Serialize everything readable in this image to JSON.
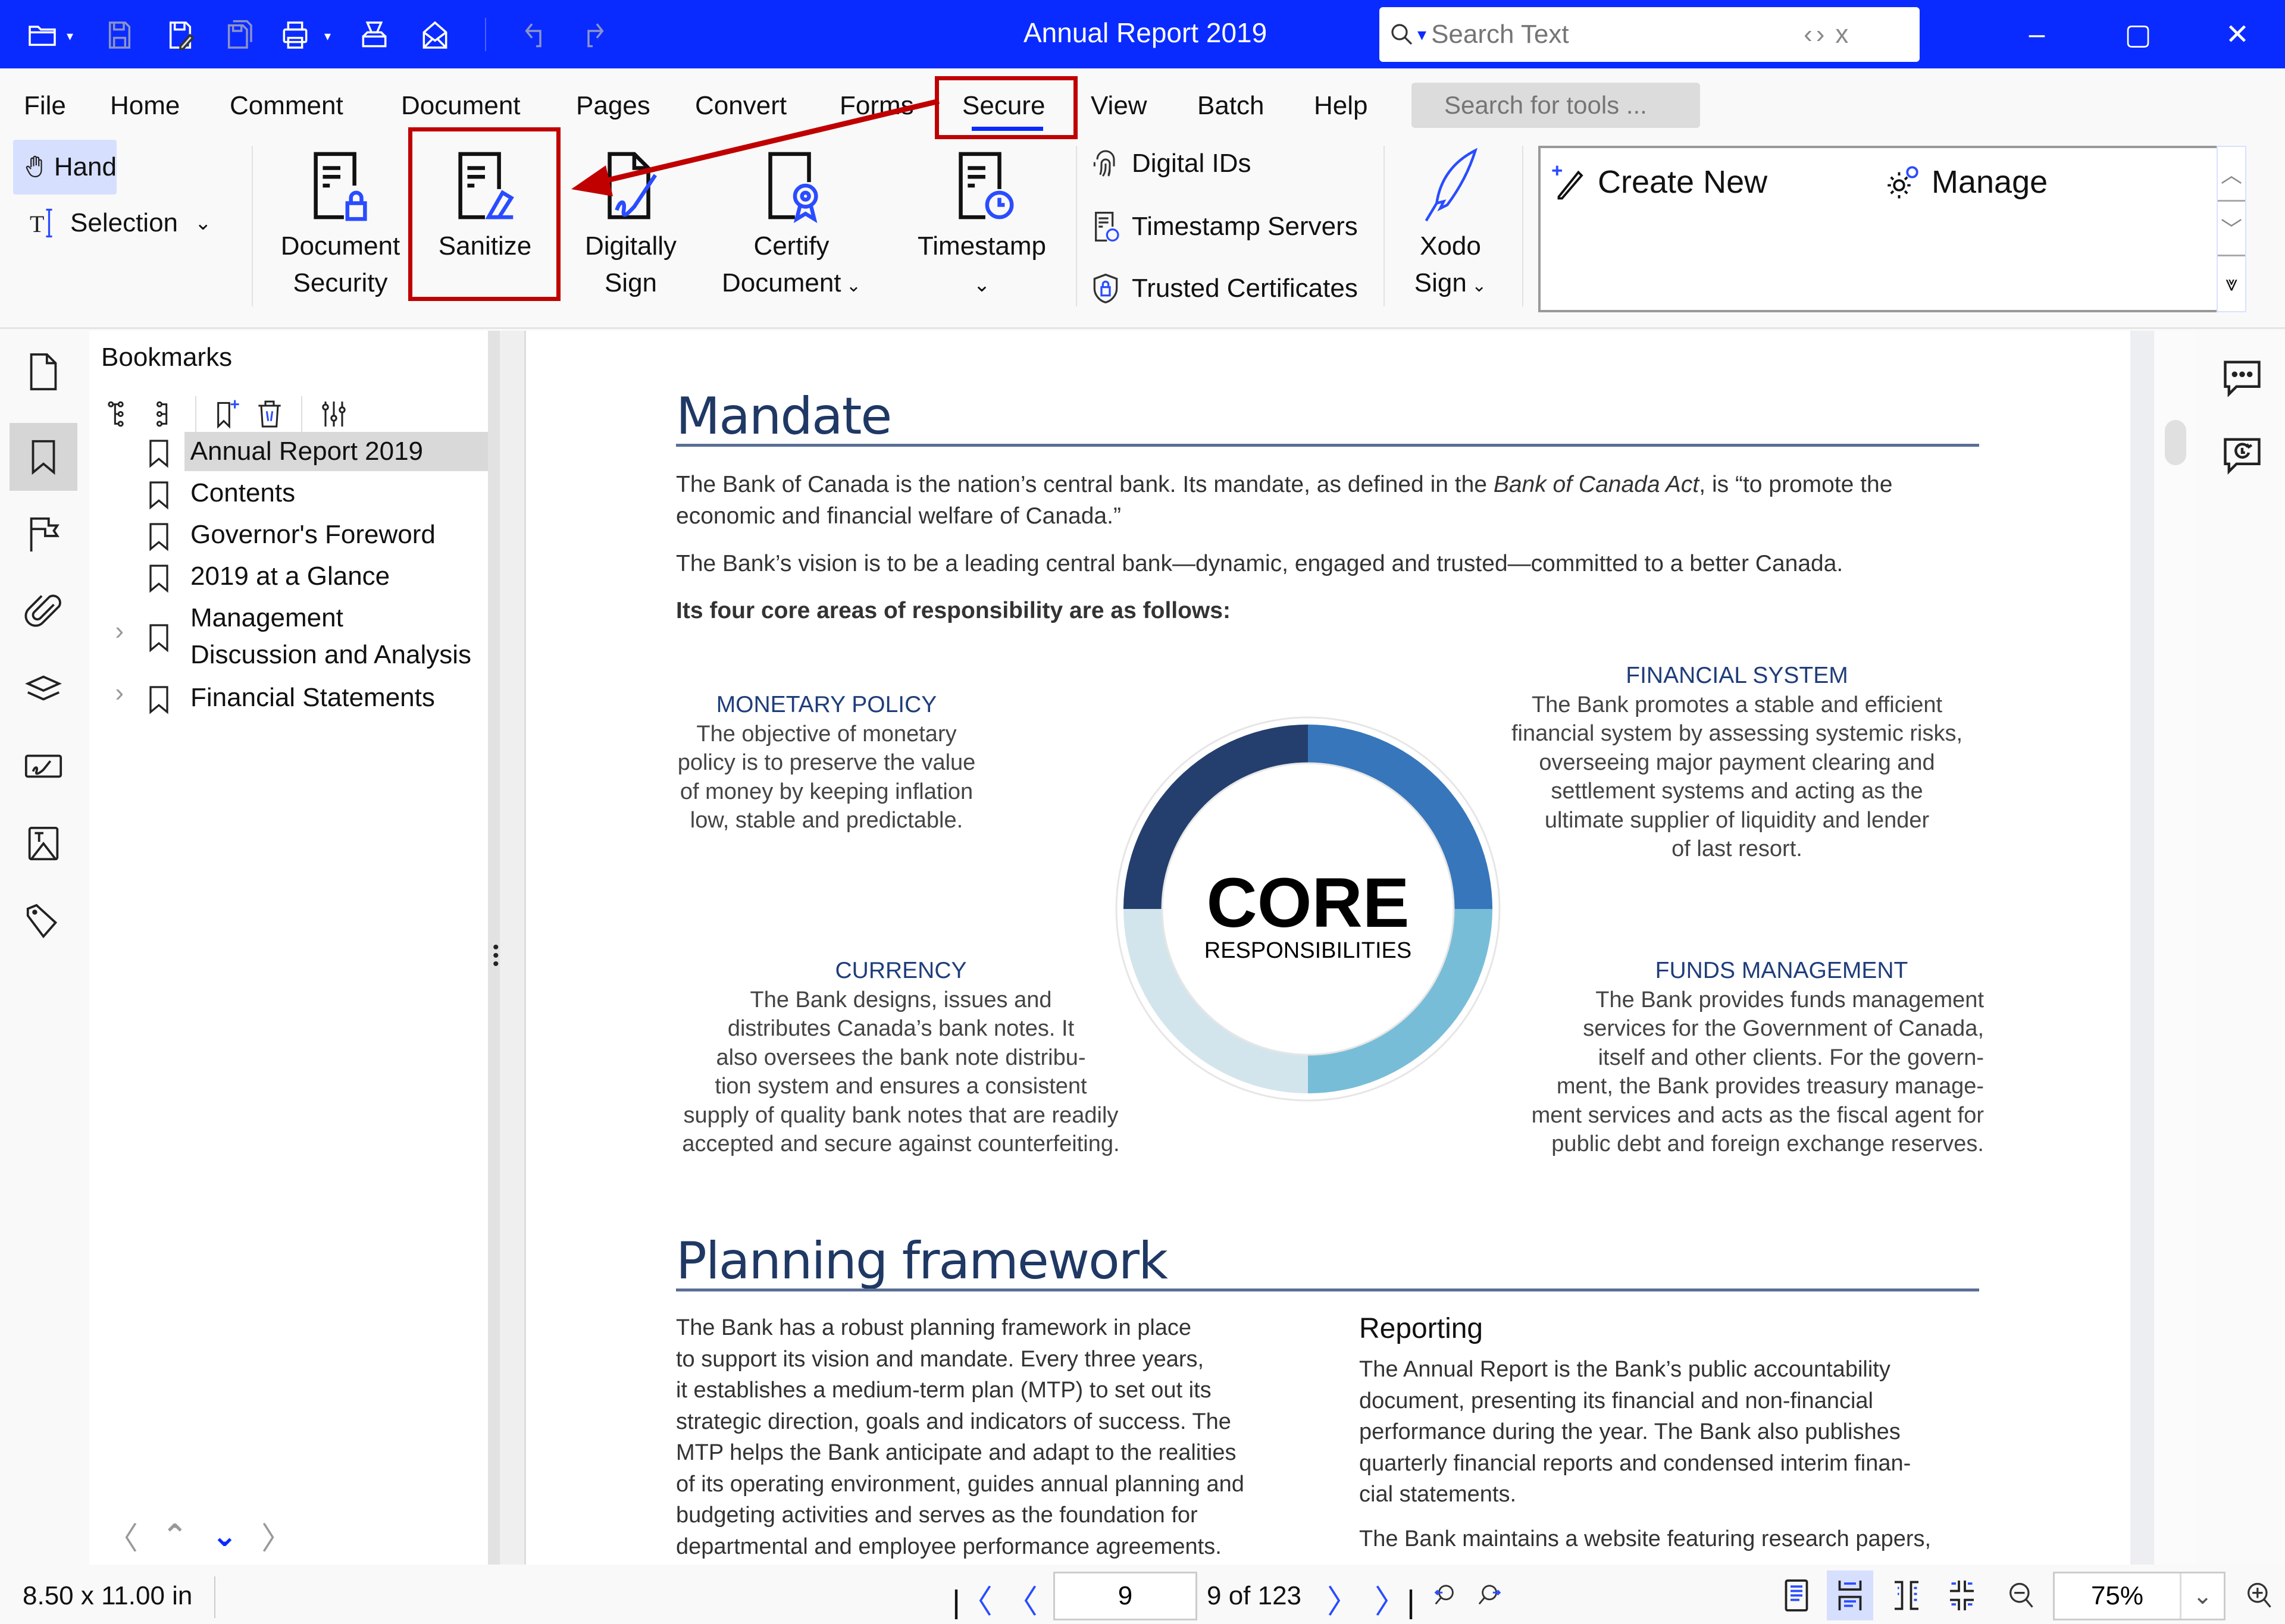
{
  "window": {
    "title": "Annual Report 2019",
    "search": {
      "placeholder": "Search Text",
      "prev": "‹",
      "next": "›",
      "close": "x"
    },
    "controls": {
      "minimize": "–",
      "maximize": "▢",
      "close": "✕"
    }
  },
  "quick_access": [
    "open-folder",
    "save",
    "save-as",
    "save-all",
    "print",
    "scan",
    "email",
    "undo",
    "redo"
  ],
  "menu": {
    "items": [
      "File",
      "Home",
      "Comment",
      "Document",
      "Pages",
      "Convert",
      "Forms",
      "Secure",
      "View",
      "Batch",
      "Help"
    ],
    "active": "Secure",
    "tools_search_placeholder": "Search for tools ..."
  },
  "ribbon": {
    "hand": "Hand",
    "selection": "Selection",
    "document_security": [
      "Document",
      "Security"
    ],
    "sanitize": "Sanitize",
    "digitally_sign": [
      "Digitally",
      "Sign"
    ],
    "certify_document": [
      "Certify",
      "Document"
    ],
    "timestamp": "Timestamp",
    "digital_ids": "Digital IDs",
    "timestamp_servers": "Timestamp Servers",
    "trusted_certificates": "Trusted Certificates",
    "xodo_sign": [
      "Xodo",
      "Sign"
    ],
    "create_new": "Create New",
    "manage": "Manage"
  },
  "annotation": {
    "highlight_color": "#c00000",
    "highlighted": [
      "Secure",
      "Sanitize"
    ]
  },
  "bookmarks": {
    "title": "Bookmarks",
    "items": [
      {
        "label": "Annual Report 2019",
        "selected": true,
        "expandable": false
      },
      {
        "label": "Contents",
        "expandable": false
      },
      {
        "label": "Governor's Foreword",
        "expandable": false
      },
      {
        "label": "2019 at a Glance",
        "expandable": false
      },
      {
        "label": "Management Discussion and Analysis",
        "line1": "Management",
        "line2": "Discussion and Analysis",
        "expandable": true
      },
      {
        "label": "Financial Statements",
        "expandable": true
      }
    ]
  },
  "document": {
    "mandate": {
      "heading": "Mandate",
      "p1_a": "The Bank of Canada is the nation’s central bank. Its mandate, as defined in the ",
      "p1_italic": "Bank of Canada Act",
      "p1_b": ", is “to promote the economic and financial welfare of Canada.”",
      "p2": "The Bank’s vision is to be a leading central bank—dynamic, engaged and trusted—committed to a better Canada.",
      "p3": "Its four core areas of responsibility are as follows:"
    },
    "core": {
      "center_title": "CORE",
      "center_subtitle": "RESPONSIBILITIES",
      "segment_colors": [
        "#243f6e",
        "#3776bb",
        "#78bdd8",
        "#d3e5ec"
      ],
      "areas": [
        {
          "title": "MONETARY POLICY",
          "lines": [
            "The objective of monetary",
            "policy is to preserve the value",
            "of money by keeping inflation",
            "low, stable and predictable."
          ]
        },
        {
          "title": "FINANCIAL SYSTEM",
          "lines": [
            "The Bank promotes a stable and efficient",
            "financial system by assessing systemic risks,",
            "overseeing major payment clearing and",
            "settlement systems and acting as the",
            "ultimate supplier of liquidity and lender",
            "of  last resort."
          ]
        },
        {
          "title": "CURRENCY",
          "lines": [
            "The Bank designs, issues and",
            "distributes Canada’s bank notes. It",
            "also oversees the bank note distribu-",
            "tion system and ensures a consistent",
            "supply of quality bank notes that are readily",
            "accepted and secure against counterfeiting."
          ]
        },
        {
          "title": "FUNDS MANAGEMENT",
          "lines": [
            "The Bank provides funds management",
            "services for the Government of Canada,",
            "itself and other clients. For the govern-",
            "ment, the Bank provides treasury manage-",
            "ment services and acts as the fiscal agent for",
            "public debt and foreign exchange reserves."
          ]
        }
      ]
    },
    "planning": {
      "heading": "Planning framework",
      "left_lines": [
        "The Bank has a robust planning framework in place",
        "to support its vision and mandate. Every three years,",
        "it establishes a medium-term plan (MTP) to set out its",
        "strategic direction, goals and indicators of success. The",
        "MTP helps the Bank anticipate and adapt to the realities",
        "of its operating environment, guides annual planning and",
        "budgeting activities and serves as the foundation for",
        "departmental and employee performance agreements."
      ],
      "reporting_heading": "Reporting",
      "reporting_lines": [
        "The Annual Report is the Bank’s public accountability",
        "document, presenting its financial and non-financial",
        "performance during the year. The Bank also publishes",
        "quarterly financial reports and condensed interim finan-",
        "cial statements."
      ],
      "reporting_p2": "The Bank maintains a website featuring research papers,"
    }
  },
  "status": {
    "page_size": "8.50 x 11.00 in",
    "current_page": "9",
    "page_of": "9 of 123",
    "zoom": "75%"
  }
}
